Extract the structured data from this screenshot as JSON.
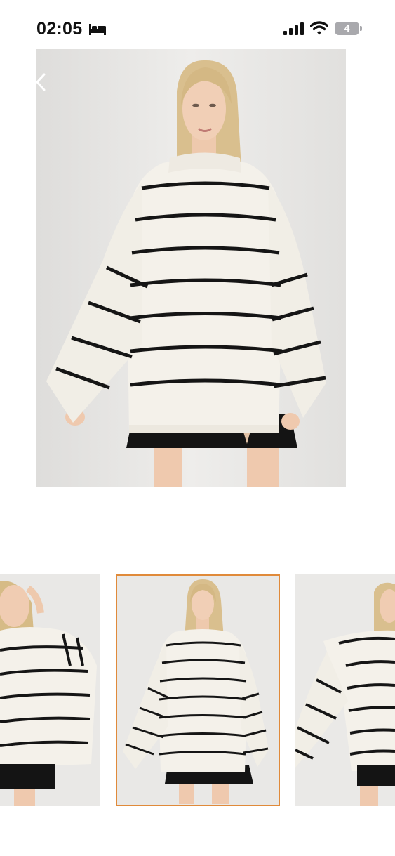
{
  "status_bar": {
    "time": "02:05",
    "battery_level": "4",
    "icons": [
      "bed-icon",
      "signal-icon",
      "wifi-icon",
      "battery-icon"
    ]
  },
  "navigation": {
    "back_icon": "chevron-left-icon"
  },
  "gallery": {
    "main_image": "product-photo-striped-sweater-front",
    "thumbnails": [
      {
        "image": "product-photo-side",
        "selected": false
      },
      {
        "image": "product-photo-front",
        "selected": true
      },
      {
        "image": "product-photo-three-quarter",
        "selected": false
      }
    ]
  },
  "colors": {
    "selected_border": "#e08a3a",
    "sweater": "#f4f1ea",
    "stripe": "#151515",
    "skirt": "#141414",
    "background": "#e6e5e3"
  }
}
